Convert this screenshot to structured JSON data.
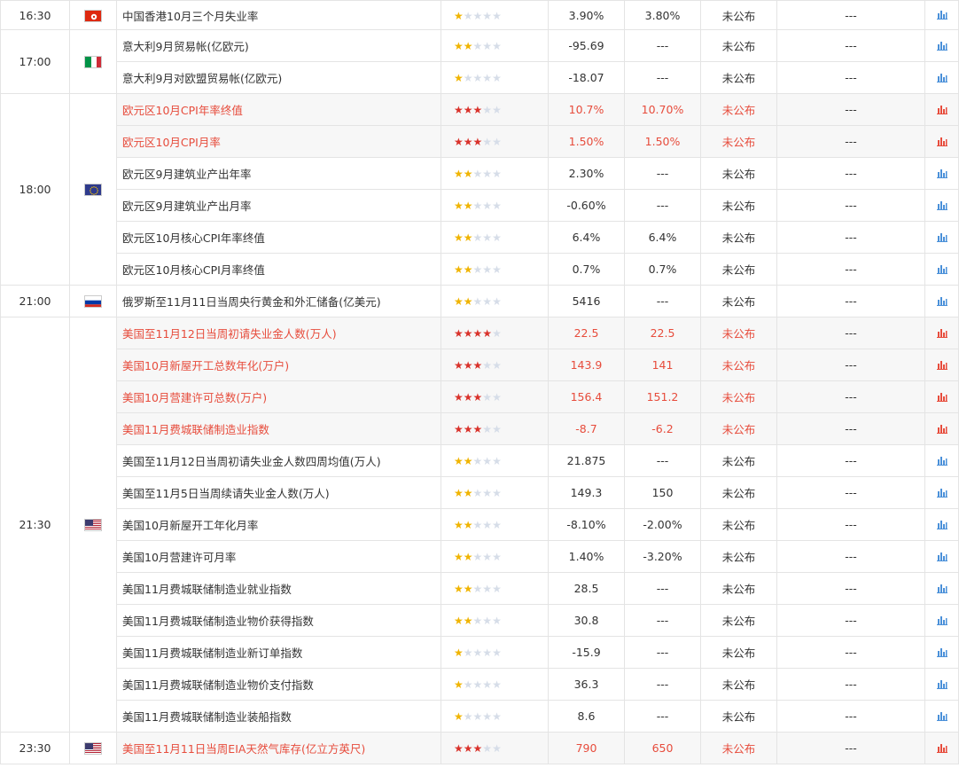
{
  "colors": {
    "highlight_text": "#e74c3c",
    "star_on": "#f0b400",
    "star_on_highlight": "#d9322b",
    "star_off": "#d6dde8",
    "chart_icon": "#4a90d9",
    "chart_icon_highlight": "#e74c3c"
  },
  "groups": [
    {
      "time": "16:30",
      "flag": "hong-kong-flag-icon",
      "rows": [
        {
          "event": "中国香港10月三个月失业率",
          "stars": 1,
          "previous": "3.90%",
          "forecast": "3.80%",
          "actual": "未公布",
          "impact": "---",
          "highlight": false
        }
      ]
    },
    {
      "time": "17:00",
      "flag": "italy-flag-icon",
      "rows": [
        {
          "event": "意大利9月贸易帐(亿欧元)",
          "stars": 2,
          "previous": "-95.69",
          "forecast": "---",
          "actual": "未公布",
          "impact": "---",
          "highlight": false
        },
        {
          "event": "意大利9月对欧盟贸易帐(亿欧元)",
          "stars": 1,
          "previous": "-18.07",
          "forecast": "---",
          "actual": "未公布",
          "impact": "---",
          "highlight": false
        }
      ]
    },
    {
      "time": "18:00",
      "flag": "eu-flag-icon",
      "rows": [
        {
          "event": "欧元区10月CPI年率终值",
          "stars": 3,
          "previous": "10.7%",
          "forecast": "10.70%",
          "actual": "未公布",
          "impact": "---",
          "highlight": true
        },
        {
          "event": "欧元区10月CPI月率",
          "stars": 3,
          "previous": "1.50%",
          "forecast": "1.50%",
          "actual": "未公布",
          "impact": "---",
          "highlight": true
        },
        {
          "event": "欧元区9月建筑业产出年率",
          "stars": 2,
          "previous": "2.30%",
          "forecast": "---",
          "actual": "未公布",
          "impact": "---",
          "highlight": false
        },
        {
          "event": "欧元区9月建筑业产出月率",
          "stars": 2,
          "previous": "-0.60%",
          "forecast": "---",
          "actual": "未公布",
          "impact": "---",
          "highlight": false
        },
        {
          "event": "欧元区10月核心CPI年率终值",
          "stars": 2,
          "previous": "6.4%",
          "forecast": "6.4%",
          "actual": "未公布",
          "impact": "---",
          "highlight": false
        },
        {
          "event": "欧元区10月核心CPI月率终值",
          "stars": 2,
          "previous": "0.7%",
          "forecast": "0.7%",
          "actual": "未公布",
          "impact": "---",
          "highlight": false
        }
      ]
    },
    {
      "time": "21:00",
      "flag": "russia-flag-icon",
      "rows": [
        {
          "event": "俄罗斯至11月11日当周央行黄金和外汇储备(亿美元)",
          "stars": 2,
          "previous": "5416",
          "forecast": "---",
          "actual": "未公布",
          "impact": "---",
          "highlight": false
        }
      ]
    },
    {
      "time": "21:30",
      "flag": "us-flag-icon",
      "rows": [
        {
          "event": "美国至11月12日当周初请失业金人数(万人)",
          "stars": 4,
          "previous": "22.5",
          "forecast": "22.5",
          "actual": "未公布",
          "impact": "---",
          "highlight": true
        },
        {
          "event": "美国10月新屋开工总数年化(万户)",
          "stars": 3,
          "previous": "143.9",
          "forecast": "141",
          "actual": "未公布",
          "impact": "---",
          "highlight": true
        },
        {
          "event": "美国10月营建许可总数(万户)",
          "stars": 3,
          "previous": "156.4",
          "forecast": "151.2",
          "actual": "未公布",
          "impact": "---",
          "highlight": true
        },
        {
          "event": "美国11月费城联储制造业指数",
          "stars": 3,
          "previous": "-8.7",
          "forecast": "-6.2",
          "actual": "未公布",
          "impact": "---",
          "highlight": true
        },
        {
          "event": "美国至11月12日当周初请失业金人数四周均值(万人)",
          "stars": 2,
          "previous": "21.875",
          "forecast": "---",
          "actual": "未公布",
          "impact": "---",
          "highlight": false
        },
        {
          "event": "美国至11月5日当周续请失业金人数(万人)",
          "stars": 2,
          "previous": "149.3",
          "forecast": "150",
          "actual": "未公布",
          "impact": "---",
          "highlight": false
        },
        {
          "event": "美国10月新屋开工年化月率",
          "stars": 2,
          "previous": "-8.10%",
          "forecast": "-2.00%",
          "actual": "未公布",
          "impact": "---",
          "highlight": false
        },
        {
          "event": "美国10月营建许可月率",
          "stars": 2,
          "previous": "1.40%",
          "forecast": "-3.20%",
          "actual": "未公布",
          "impact": "---",
          "highlight": false
        },
        {
          "event": "美国11月费城联储制造业就业指数",
          "stars": 2,
          "previous": "28.5",
          "forecast": "---",
          "actual": "未公布",
          "impact": "---",
          "highlight": false
        },
        {
          "event": "美国11月费城联储制造业物价获得指数",
          "stars": 2,
          "previous": "30.8",
          "forecast": "---",
          "actual": "未公布",
          "impact": "---",
          "highlight": false
        },
        {
          "event": "美国11月费城联储制造业新订单指数",
          "stars": 1,
          "previous": "-15.9",
          "forecast": "---",
          "actual": "未公布",
          "impact": "---",
          "highlight": false
        },
        {
          "event": "美国11月费城联储制造业物价支付指数",
          "stars": 1,
          "previous": "36.3",
          "forecast": "---",
          "actual": "未公布",
          "impact": "---",
          "highlight": false
        },
        {
          "event": "美国11月费城联储制造业装船指数",
          "stars": 1,
          "previous": "8.6",
          "forecast": "---",
          "actual": "未公布",
          "impact": "---",
          "highlight": false
        }
      ]
    },
    {
      "time": "23:30",
      "flag": "us-flag-icon",
      "rows": [
        {
          "event": "美国至11月11日当周EIA天然气库存(亿立方英尺)",
          "stars": 3,
          "previous": "790",
          "forecast": "650",
          "actual": "未公布",
          "impact": "---",
          "highlight": true
        }
      ]
    }
  ]
}
